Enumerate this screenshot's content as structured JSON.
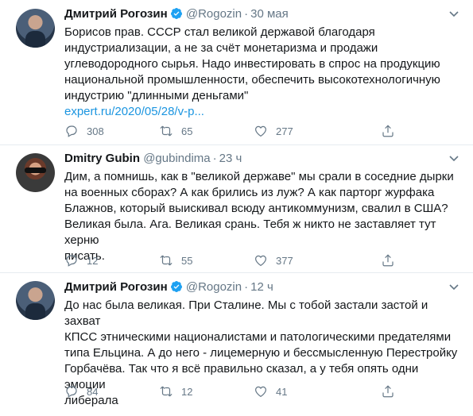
{
  "tweets": [
    {
      "name": "Дмитрий Рогозин",
      "handle": "@Rogozin",
      "time": "30 мая",
      "verified": true,
      "text_lines": [
        "Борисов прав. СССР стал великой державой благодаря",
        "индустриализации, а не за счёт монетаризма и продажи",
        "углеводородного сырья. Надо инвестировать в спрос на продукцию",
        "национальной промышленности, обеспечить высокотехнологичную",
        "индустрию \"длинными деньгами\""
      ],
      "link": "expert.ru/2020/05/28/v-p...",
      "replies": "308",
      "retweets": "65",
      "likes": "277"
    },
    {
      "name": "Dmitry Gubin",
      "handle": "@gubindima",
      "time": "23 ч",
      "verified": false,
      "text_lines": [
        "Дим, а помнишь, как в \"великой державе\" мы срали в соседние дырки",
        "на военных сборах? А как брились из луж? А как парторг журфака",
        "Блажнов, который выискивал всюду антикоммунизм, свалил в США?",
        "Великая была. Ага. Великая срань. Тебя ж никто не заставляет тут херню",
        "писать."
      ],
      "link": "",
      "replies": "12",
      "retweets": "55",
      "likes": "377"
    },
    {
      "name": "Дмитрий Рогозин",
      "handle": "@Rogozin",
      "time": "12 ч",
      "verified": true,
      "text_lines": [
        "До нас была великая. При Сталине. Мы с тобой застали застой и захват",
        "КПСС этническими националистами и патологическими предателями",
        "типа Ельцина. А до него - лицемерную и бессмысленную Перестройку",
        "Горбачёва. Так что я всё правильно сказал, а у тебя опять одни эмоции",
        "либерала"
      ],
      "link": "",
      "replies": "84",
      "retweets": "12",
      "likes": "41"
    }
  ],
  "colors": {
    "text": "#14171a",
    "muted": "#657786",
    "link": "#1b95e0",
    "verified": "#1da1f2",
    "divider": "#e6ecf0"
  },
  "icons": [
    "reply-icon",
    "retweet-icon",
    "like-icon",
    "share-icon",
    "verified-badge-icon",
    "caret-down-icon"
  ]
}
